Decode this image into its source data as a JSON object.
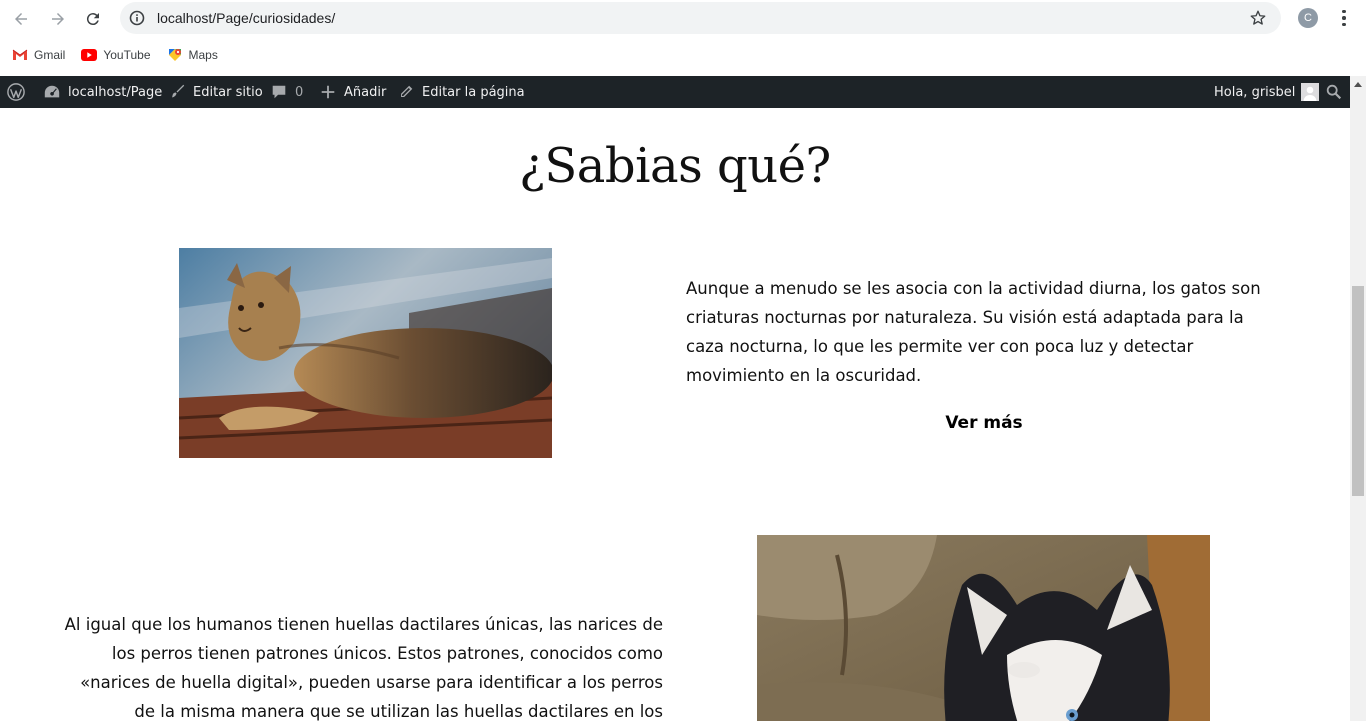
{
  "browser": {
    "url": "localhost/Page/curiosidades/",
    "profile_initial": "C",
    "bookmarks": [
      {
        "label": "Gmail",
        "icon": "gmail-icon"
      },
      {
        "label": "YouTube",
        "icon": "youtube-icon"
      },
      {
        "label": "Maps",
        "icon": "maps-icon"
      }
    ]
  },
  "adminbar": {
    "site": "localhost/Page",
    "edit_site": "Editar sitio",
    "comments_count": "0",
    "add_new": "Añadir",
    "edit_page": "Editar la página",
    "greeting": "Hola, grisbel"
  },
  "page": {
    "title": "¿Sabias qué?",
    "cat_text": "Aunque a menudo se les asocia con la actividad diurna, los gatos son criaturas nocturnas por naturaleza. Su visión está adaptada para la caza nocturna, lo que les permite ver con poca luz y detectar movimiento en la oscuridad.",
    "ver_mas": "Ver más",
    "dog_text": "Al igual que los humanos tienen huellas dactilares únicas, las narices de los perros tienen patrones únicos. Estos patrones, conocidos como «narices de huella digital», pueden usarse para identificar a los perros de la misma manera que se utilizan las huellas dactilares en los humanos."
  }
}
